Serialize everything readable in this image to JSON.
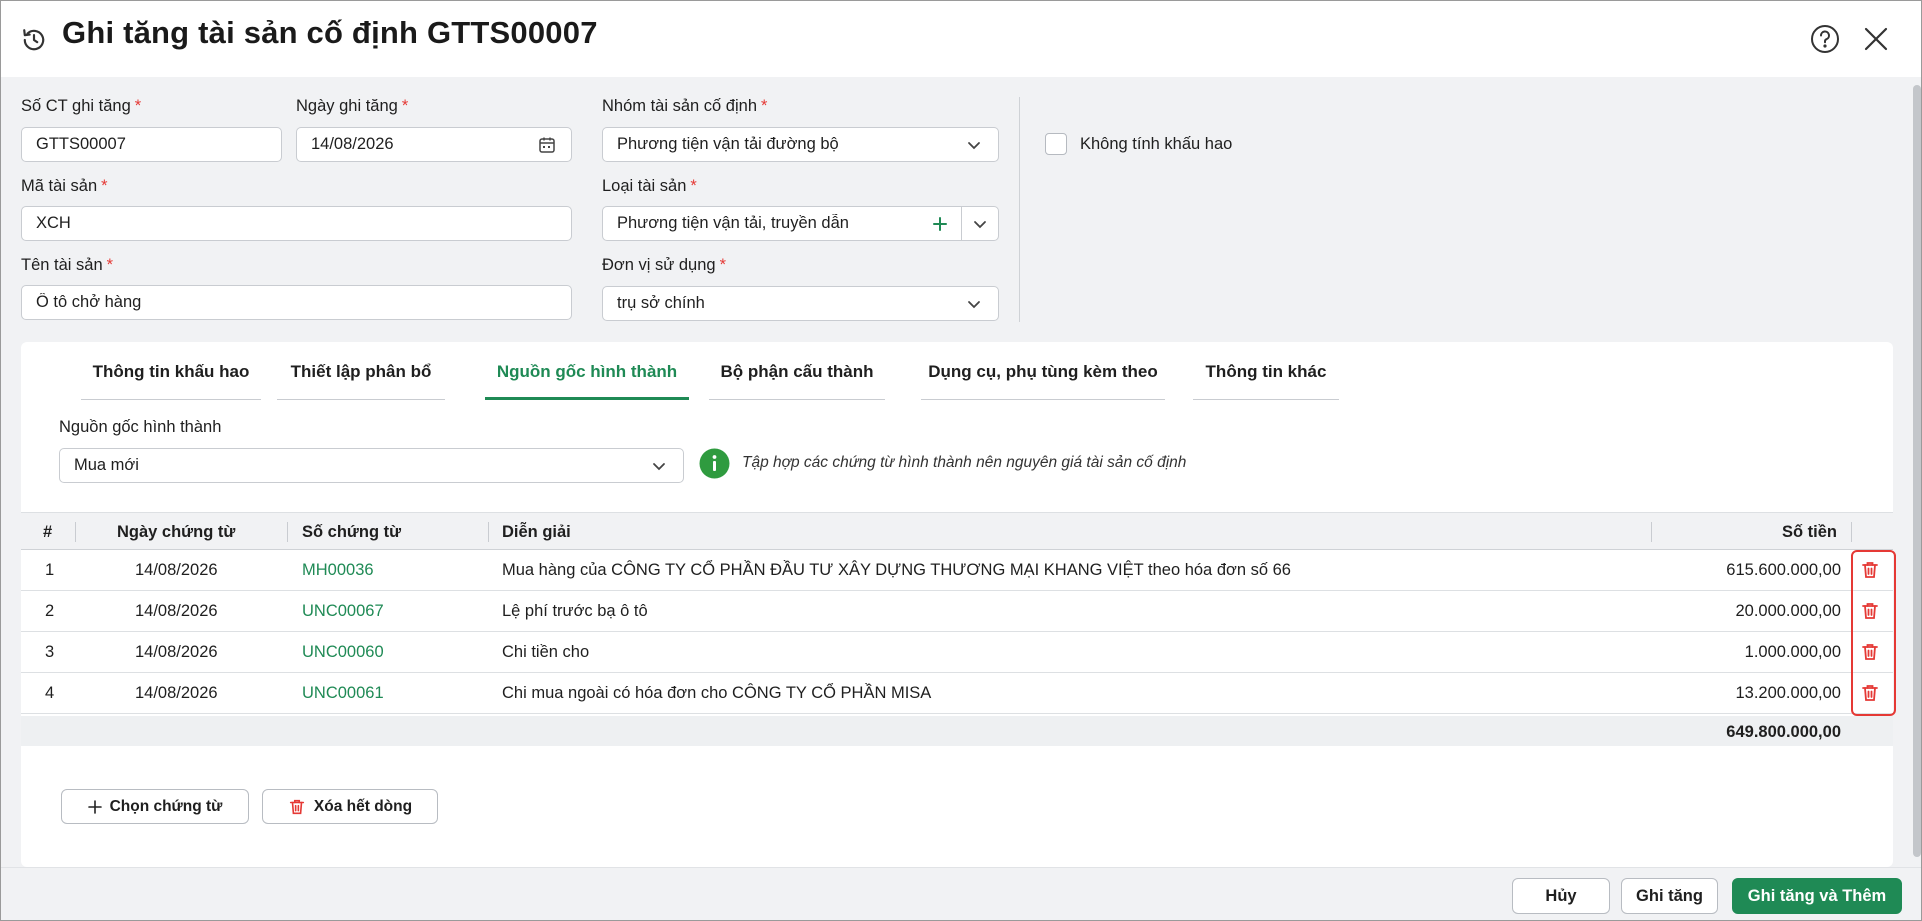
{
  "title": "Ghi tăng tài sản cố định GTTS00007",
  "form": {
    "voucher_no": {
      "label": "Số CT ghi tăng",
      "value": "GTTS00007"
    },
    "date": {
      "label": "Ngày ghi tăng",
      "value": "14/08/2026"
    },
    "asset_group": {
      "label": "Nhóm tài sản cố định",
      "value": "Phương tiện vận tải đường bộ"
    },
    "asset_code": {
      "label": "Mã tài sản",
      "value": "XCH"
    },
    "asset_type": {
      "label": "Loại tài sản",
      "value": "Phương tiện vận tải, truyền dẫn"
    },
    "asset_name": {
      "label": "Tên tài sản",
      "value": "Ô tô chở hàng"
    },
    "unit": {
      "label": "Đơn vị sử dụng",
      "value": "trụ sở chính"
    },
    "required_mark": "*",
    "no_depreciation": {
      "label": "Không tính khấu hao",
      "checked": false
    }
  },
  "tabs": [
    {
      "label": "Thông tin khấu hao"
    },
    {
      "label": "Thiết lập phân bổ"
    },
    {
      "label": "Nguồn gốc hình thành",
      "active": true
    },
    {
      "label": "Bộ phận cấu thành"
    },
    {
      "label": "Dụng cụ, phụ tùng kèm theo"
    },
    {
      "label": "Thông tin khác"
    }
  ],
  "source": {
    "label": "Nguồn gốc hình thành",
    "value": "Mua mới",
    "info": "Tập hợp các chứng từ hình thành nên nguyên giá tài sản cố định"
  },
  "table": {
    "headers": {
      "index": "#",
      "date": "Ngày chứng từ",
      "voucher": "Số chứng từ",
      "description": "Diễn giải",
      "amount": "Số tiền"
    },
    "rows": [
      {
        "index": "1",
        "date": "14/08/2026",
        "voucher": "MH00036",
        "description": "Mua hàng của CÔNG TY CỔ PHẦN ĐẦU TƯ XÂY DỰNG THƯƠNG MẠI KHANG VIỆT theo hóa đơn số 66",
        "amount": "615.600.000,00"
      },
      {
        "index": "2",
        "date": "14/08/2026",
        "voucher": "UNC00067",
        "description": "Lệ phí trước bạ ô tô",
        "amount": "20.000.000,00"
      },
      {
        "index": "3",
        "date": "14/08/2026",
        "voucher": "UNC00060",
        "description": "Chi tiền cho",
        "amount": "1.000.000,00"
      },
      {
        "index": "4",
        "date": "14/08/2026",
        "voucher": "UNC00061",
        "description": "Chi mua ngoài có hóa đơn cho  CÔNG TY CỔ PHẦN MISA",
        "amount": "13.200.000,00"
      }
    ],
    "total": "649.800.000,00"
  },
  "panel_buttons": {
    "choose": "Chọn chứng từ",
    "delete_all": "Xóa hết dòng"
  },
  "footer": {
    "cancel": "Hủy",
    "save": "Ghi tăng",
    "save_add": "Ghi tăng và Thêm"
  },
  "colors": {
    "accent": "#1f8a55",
    "danger": "#e53935"
  },
  "icons": [
    "history-icon",
    "help-icon",
    "close-icon",
    "calendar-icon",
    "chevron-down-icon",
    "plus-icon",
    "info-icon",
    "trash-icon"
  ]
}
